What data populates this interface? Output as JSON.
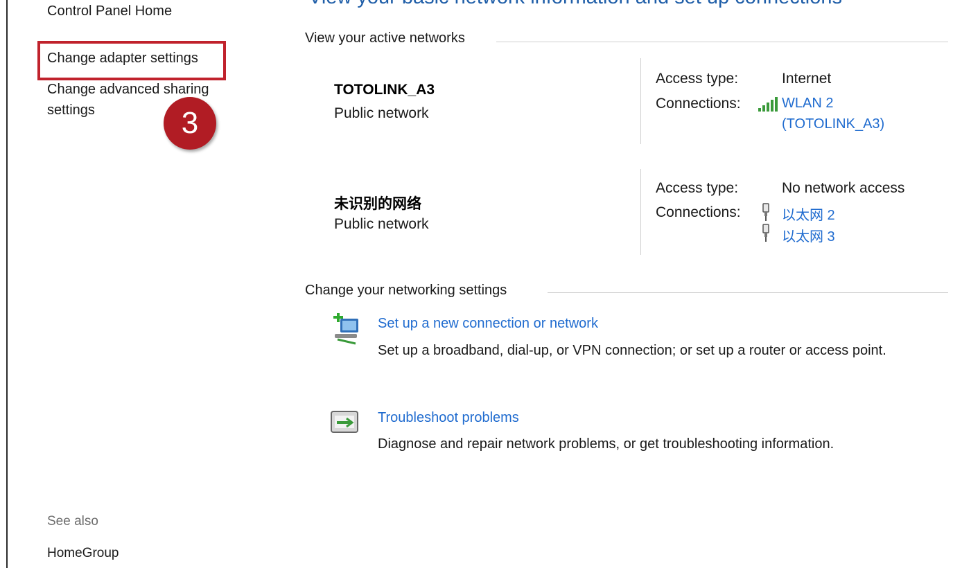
{
  "sidebar": {
    "home": "Control Panel Home",
    "change_adapter": "Change adapter settings",
    "change_advanced": "Change advanced sharing settings",
    "step_badge": "3",
    "see_also": "See also",
    "homegroup": "HomeGroup"
  },
  "main": {
    "title": "View your basic network information and set up connections",
    "active_networks_header": "View your active networks",
    "networks": [
      {
        "name": "TOTOLINK_A3",
        "type": "Public network",
        "access_type_label": "Access type:",
        "access_type": "Internet",
        "connections_label": "Connections:",
        "connections": [
          "WLAN 2",
          "(TOTOLINK_A3)"
        ]
      },
      {
        "name": "未识别的网络",
        "type": "Public network",
        "access_type_label": "Access type:",
        "access_type": "No network access",
        "connections_label": "Connections:",
        "connections": [
          "以太网 2",
          "以太网 3"
        ]
      }
    ],
    "change_settings_header": "Change your networking settings",
    "tasks": [
      {
        "link": "Set up a new connection or network",
        "desc": "Set up a broadband, dial-up, or VPN connection; or set up a router or access point."
      },
      {
        "link": "Troubleshoot problems",
        "desc": "Diagnose and repair network problems, or get troubleshooting information."
      }
    ]
  },
  "icons": {
    "wifi": "wifi-signal-icon",
    "ethernet": "ethernet-icon",
    "new_connection": "new-connection-icon",
    "troubleshoot": "troubleshoot-icon"
  },
  "colors": {
    "link": "#1f6bcf",
    "title": "#1f5ea8",
    "highlight": "#c0222c",
    "badge": "#b11c24"
  }
}
